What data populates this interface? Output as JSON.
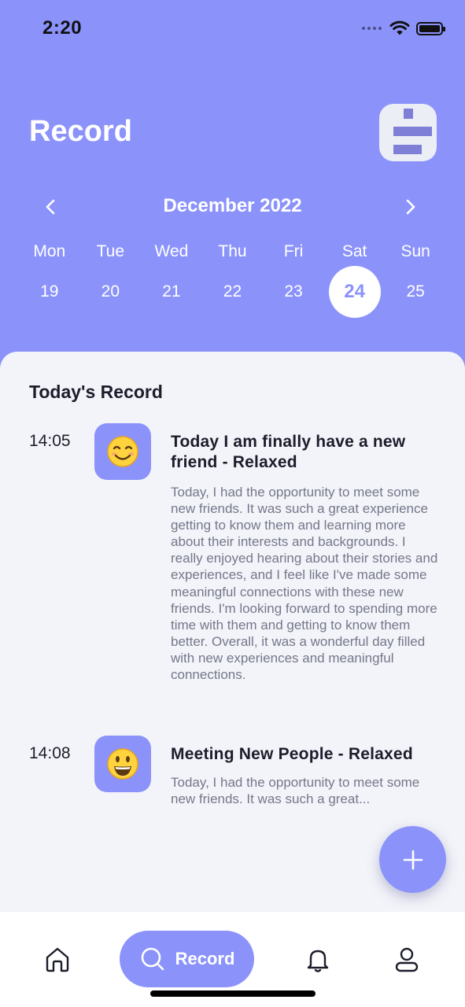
{
  "status_bar": {
    "time": "2:20"
  },
  "header": {
    "title": "Record"
  },
  "calendar": {
    "month_label": "December 2022",
    "weekdays": [
      "Mon",
      "Tue",
      "Wed",
      "Thu",
      "Fri",
      "Sat",
      "Sun"
    ],
    "dates": [
      "19",
      "20",
      "21",
      "22",
      "23",
      "24",
      "25"
    ],
    "selected": "24"
  },
  "records": {
    "section_title": "Today's Record",
    "entries": [
      {
        "time": "14:05",
        "emoji": "😊",
        "title": "Today I am finally have a new friend - Relaxed",
        "body": "Today, I had the opportunity to meet some new friends. It was such a great experience getting to know them and learning more about their interests and backgrounds. I really enjoyed hearing about their stories and experiences, and I feel like I've made some meaningful connections with these new friends. I'm looking forward to spending more time with them and getting to know them better. Overall, it was a wonderful day filled with new experiences and meaningful connections."
      },
      {
        "time": "14:08",
        "emoji": "😃",
        "title": "Meeting New People - Relaxed",
        "body": "Today, I had the opportunity to meet some new friends. It was such a great..."
      }
    ]
  },
  "tab_bar": {
    "active_label": "Record",
    "icons": [
      "home-icon",
      "search-icon",
      "bell-icon",
      "profile-icon"
    ]
  },
  "colors": {
    "accent": "#8b93fb",
    "sheet_background": "#f3f4f9",
    "text_dark": "#1c1d2b",
    "text_muted": "#74778a"
  }
}
